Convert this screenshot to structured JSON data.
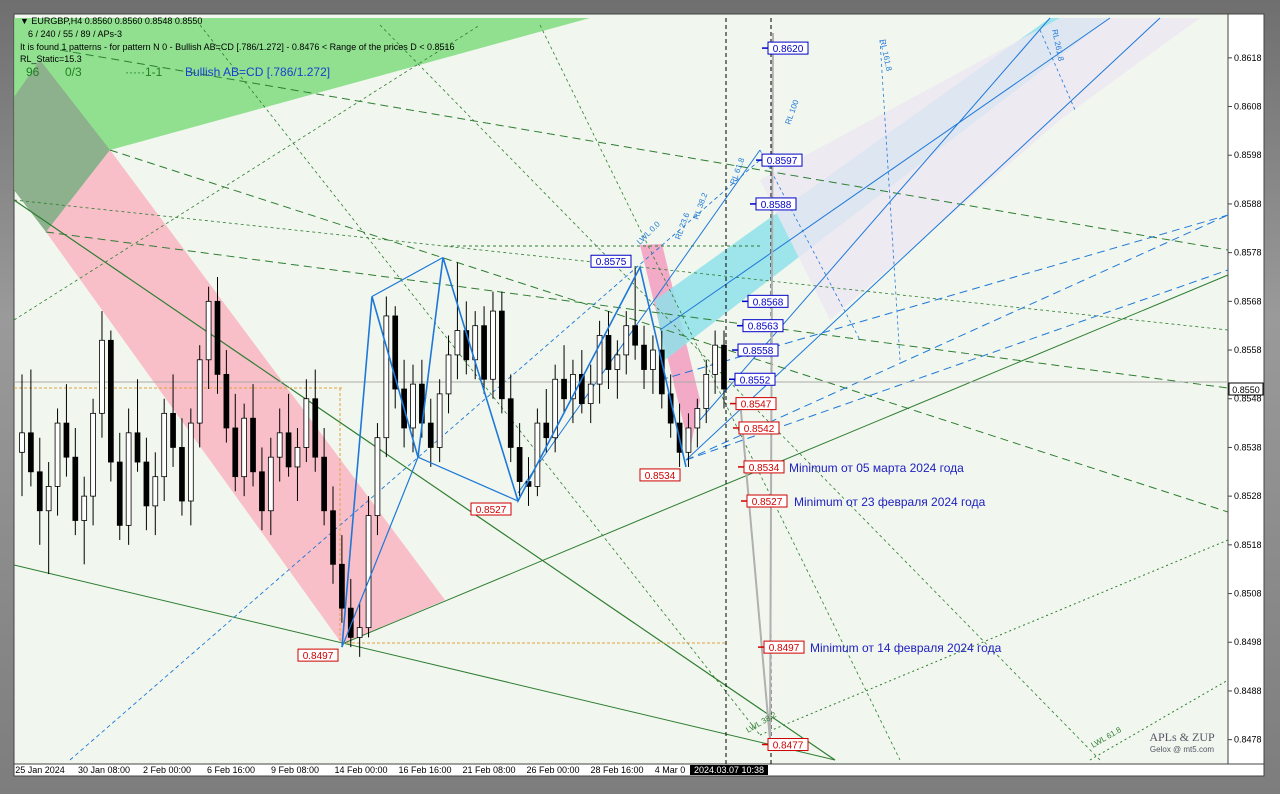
{
  "header": {
    "symbol_line": "EURGBP,H4  0.8560 0.8560 0.8548 0.8550",
    "params_line": "6 / 240 / 55 / 89 / APs-3",
    "pattern_line": "It is found 1 patterns  -  for pattern N 0 - Bullish AB=CD [.786/1.272] - 0.8476 < Range of the prices D < 0.8516",
    "rl_static": "RL_Static=15.3",
    "status_96": "96",
    "status_03": "0/3",
    "status_11": "1-1",
    "pattern_name": "Bullish AB=CD [.786/1.272]"
  },
  "colors": {
    "background": "#f1f7ee",
    "bull_candle": "#ffffff",
    "bear_candle": "#000000",
    "pattern_line": "#1e78d8",
    "green_zone": "#7fdc7f",
    "pink_zone": "#f8b8c4",
    "cyan_channel": "#8fe0ea",
    "blue_label": "#0000c8",
    "red_label": "#d00000",
    "annotation": "#2020c0"
  },
  "chart_data": {
    "type": "candlestick",
    "symbol": "EURGBP",
    "timeframe": "H4",
    "ylim": [
      0.8473,
      0.8627
    ],
    "y_ticks": [
      "0.8618",
      "0.8608",
      "0.8598",
      "0.8588",
      "0.8578",
      "0.8568",
      "0.8558",
      "0.8548",
      "0.8538",
      "0.8528",
      "0.8518",
      "0.8508",
      "0.8498",
      "0.8488",
      "0.8478"
    ],
    "x_ticks": [
      "25 Jan 2024",
      "30 Jan 08:00",
      "2 Feb 00:00",
      "6 Feb 16:00",
      "9 Feb 08:00",
      "14 Feb 00:00",
      "16 Feb 16:00",
      "21 Feb 08:00",
      "26 Feb 00:00",
      "28 Feb 16:00",
      "4 Mar 0"
    ],
    "current_time_label": "2024.03.07 10:38",
    "last_price": "0.8550",
    "bars": [
      [
        0.8537,
        0.8553,
        0.8528,
        0.8541
      ],
      [
        0.8541,
        0.8554,
        0.853,
        0.8533
      ],
      [
        0.8533,
        0.854,
        0.8518,
        0.8525
      ],
      [
        0.8525,
        0.8535,
        0.8512,
        0.853
      ],
      [
        0.853,
        0.8546,
        0.8524,
        0.8543
      ],
      [
        0.8543,
        0.8551,
        0.8532,
        0.8536
      ],
      [
        0.8536,
        0.8542,
        0.852,
        0.8523
      ],
      [
        0.8523,
        0.8532,
        0.8514,
        0.8528
      ],
      [
        0.8528,
        0.8548,
        0.8522,
        0.8545
      ],
      [
        0.8545,
        0.8566,
        0.854,
        0.856
      ],
      [
        0.856,
        0.8562,
        0.8531,
        0.8535
      ],
      [
        0.8535,
        0.8541,
        0.8519,
        0.8522
      ],
      [
        0.8522,
        0.8546,
        0.8518,
        0.8541
      ],
      [
        0.8541,
        0.8552,
        0.8533,
        0.8535
      ],
      [
        0.8535,
        0.854,
        0.8521,
        0.8526
      ],
      [
        0.8526,
        0.8537,
        0.852,
        0.8532
      ],
      [
        0.8532,
        0.8548,
        0.8527,
        0.8545
      ],
      [
        0.8545,
        0.8553,
        0.8534,
        0.8538
      ],
      [
        0.8538,
        0.8544,
        0.8524,
        0.8527
      ],
      [
        0.8527,
        0.8546,
        0.8522,
        0.8543
      ],
      [
        0.8543,
        0.8559,
        0.8538,
        0.8556
      ],
      [
        0.8556,
        0.8571,
        0.855,
        0.8568
      ],
      [
        0.8568,
        0.8573,
        0.8549,
        0.8553
      ],
      [
        0.8553,
        0.8558,
        0.8539,
        0.8542
      ],
      [
        0.8542,
        0.8549,
        0.8529,
        0.8532
      ],
      [
        0.8532,
        0.8547,
        0.8528,
        0.8544
      ],
      [
        0.8544,
        0.8551,
        0.853,
        0.8533
      ],
      [
        0.8533,
        0.8538,
        0.8521,
        0.8525
      ],
      [
        0.8525,
        0.854,
        0.852,
        0.8536
      ],
      [
        0.8536,
        0.8546,
        0.8531,
        0.8541
      ],
      [
        0.8541,
        0.8549,
        0.8532,
        0.8534
      ],
      [
        0.8534,
        0.8542,
        0.8527,
        0.8538
      ],
      [
        0.8538,
        0.8552,
        0.8535,
        0.8548
      ],
      [
        0.8548,
        0.8554,
        0.8533,
        0.8536
      ],
      [
        0.8536,
        0.8542,
        0.8522,
        0.8525
      ],
      [
        0.8525,
        0.853,
        0.851,
        0.8514
      ],
      [
        0.8514,
        0.852,
        0.8502,
        0.8505
      ],
      [
        0.8505,
        0.8511,
        0.8497,
        0.8499
      ],
      [
        0.8499,
        0.8506,
        0.8495,
        0.8501
      ],
      [
        0.8501,
        0.8528,
        0.8499,
        0.8524
      ],
      [
        0.8524,
        0.8543,
        0.852,
        0.854
      ],
      [
        0.854,
        0.8569,
        0.8536,
        0.8565
      ],
      [
        0.8565,
        0.8567,
        0.8546,
        0.855
      ],
      [
        0.855,
        0.8556,
        0.8538,
        0.8542
      ],
      [
        0.8542,
        0.8555,
        0.8537,
        0.8551
      ],
      [
        0.8551,
        0.8556,
        0.854,
        0.8543
      ],
      [
        0.8543,
        0.8548,
        0.8534,
        0.8538
      ],
      [
        0.8538,
        0.8552,
        0.8535,
        0.8549
      ],
      [
        0.8549,
        0.8561,
        0.8545,
        0.8557
      ],
      [
        0.8557,
        0.8576,
        0.8552,
        0.8562
      ],
      [
        0.8562,
        0.8568,
        0.8553,
        0.8556
      ],
      [
        0.8556,
        0.8566,
        0.8552,
        0.8563
      ],
      [
        0.8563,
        0.8567,
        0.8549,
        0.8552
      ],
      [
        0.8552,
        0.857,
        0.8548,
        0.8566
      ],
      [
        0.8566,
        0.857,
        0.8545,
        0.8548
      ],
      [
        0.8548,
        0.8553,
        0.8535,
        0.8538
      ],
      [
        0.8538,
        0.8543,
        0.8528,
        0.8531
      ],
      [
        0.8531,
        0.8536,
        0.8526,
        0.853
      ],
      [
        0.853,
        0.8546,
        0.8528,
        0.8543
      ],
      [
        0.8543,
        0.855,
        0.8537,
        0.854
      ],
      [
        0.854,
        0.8555,
        0.8537,
        0.8552
      ],
      [
        0.8552,
        0.8559,
        0.8545,
        0.8548
      ],
      [
        0.8548,
        0.8556,
        0.8543,
        0.8553
      ],
      [
        0.8553,
        0.8558,
        0.8545,
        0.8547
      ],
      [
        0.8547,
        0.8555,
        0.8543,
        0.8551
      ],
      [
        0.8551,
        0.8564,
        0.8547,
        0.8561
      ],
      [
        0.8561,
        0.8566,
        0.855,
        0.8554
      ],
      [
        0.8554,
        0.856,
        0.8548,
        0.8557
      ],
      [
        0.8557,
        0.8566,
        0.8553,
        0.8563
      ],
      [
        0.8563,
        0.8575,
        0.8556,
        0.8559
      ],
      [
        0.8559,
        0.8563,
        0.855,
        0.8554
      ],
      [
        0.8554,
        0.8561,
        0.8549,
        0.8558
      ],
      [
        0.8558,
        0.8562,
        0.8546,
        0.8549
      ],
      [
        0.8549,
        0.8553,
        0.854,
        0.8543
      ],
      [
        0.8543,
        0.8547,
        0.8534,
        0.8537
      ],
      [
        0.8537,
        0.8545,
        0.8534,
        0.8542
      ],
      [
        0.8542,
        0.8548,
        0.8538,
        0.8546
      ],
      [
        0.8546,
        0.8556,
        0.8543,
        0.8553
      ],
      [
        0.8553,
        0.8562,
        0.8549,
        0.8559
      ],
      [
        0.8559,
        0.8562,
        0.8546,
        0.855
      ]
    ],
    "pattern_points": [
      {
        "label": "0.8497",
        "price": 0.8497,
        "kind": "low"
      },
      {
        "label": "",
        "price": 0.8569,
        "kind": "high"
      },
      {
        "label": "",
        "price": 0.8536,
        "kind": "low"
      },
      {
        "label": "",
        "price": 0.8577,
        "kind": "high"
      },
      {
        "label": "0.8527",
        "price": 0.8527,
        "kind": "low"
      },
      {
        "label": "0.8575",
        "price": 0.8575,
        "kind": "high"
      },
      {
        "label": "0.8534",
        "price": 0.8534,
        "kind": "low"
      }
    ],
    "target_levels": [
      {
        "label": "0.8620",
        "price": 0.862,
        "color": "blue"
      },
      {
        "label": "0.8597",
        "price": 0.8597,
        "color": "blue"
      },
      {
        "label": "0.8588",
        "price": 0.8588,
        "color": "blue"
      },
      {
        "label": "0.8568",
        "price": 0.8568,
        "color": "blue"
      },
      {
        "label": "0.8563",
        "price": 0.8563,
        "color": "blue"
      },
      {
        "label": "0.8558",
        "price": 0.8558,
        "color": "blue"
      },
      {
        "label": "0.8552",
        "price": 0.8552,
        "color": "blue"
      },
      {
        "label": "0.8547",
        "price": 0.8547,
        "color": "red"
      },
      {
        "label": "0.8542",
        "price": 0.8542,
        "color": "red"
      },
      {
        "label": "0.8534",
        "price": 0.8534,
        "color": "red"
      },
      {
        "label": "0.8527",
        "price": 0.8527,
        "color": "red"
      },
      {
        "label": "0.8497",
        "price": 0.8497,
        "color": "red"
      },
      {
        "label": "0.8477",
        "price": 0.8477,
        "color": "red"
      }
    ],
    "annotations": [
      {
        "text": "Minimum от 05 марта 2024 года",
        "price": 0.8534
      },
      {
        "text": "Minimum от 23 февраля 2024 года",
        "price": 0.8527
      },
      {
        "text": "Minimum от 14 февраля 2024 года",
        "price": 0.8497
      }
    ],
    "fib_labels": [
      "RL 161.8",
      "RL 61.8",
      "RL 38.2",
      "RL 23.6",
      "RL 100",
      "LWL 0.0",
      "RL 261.8",
      "LWL 38.2",
      "LWL 61.8"
    ],
    "watermark_line1": "APLs & ZUP",
    "watermark_line2": "Gelox @ mt5.com"
  }
}
